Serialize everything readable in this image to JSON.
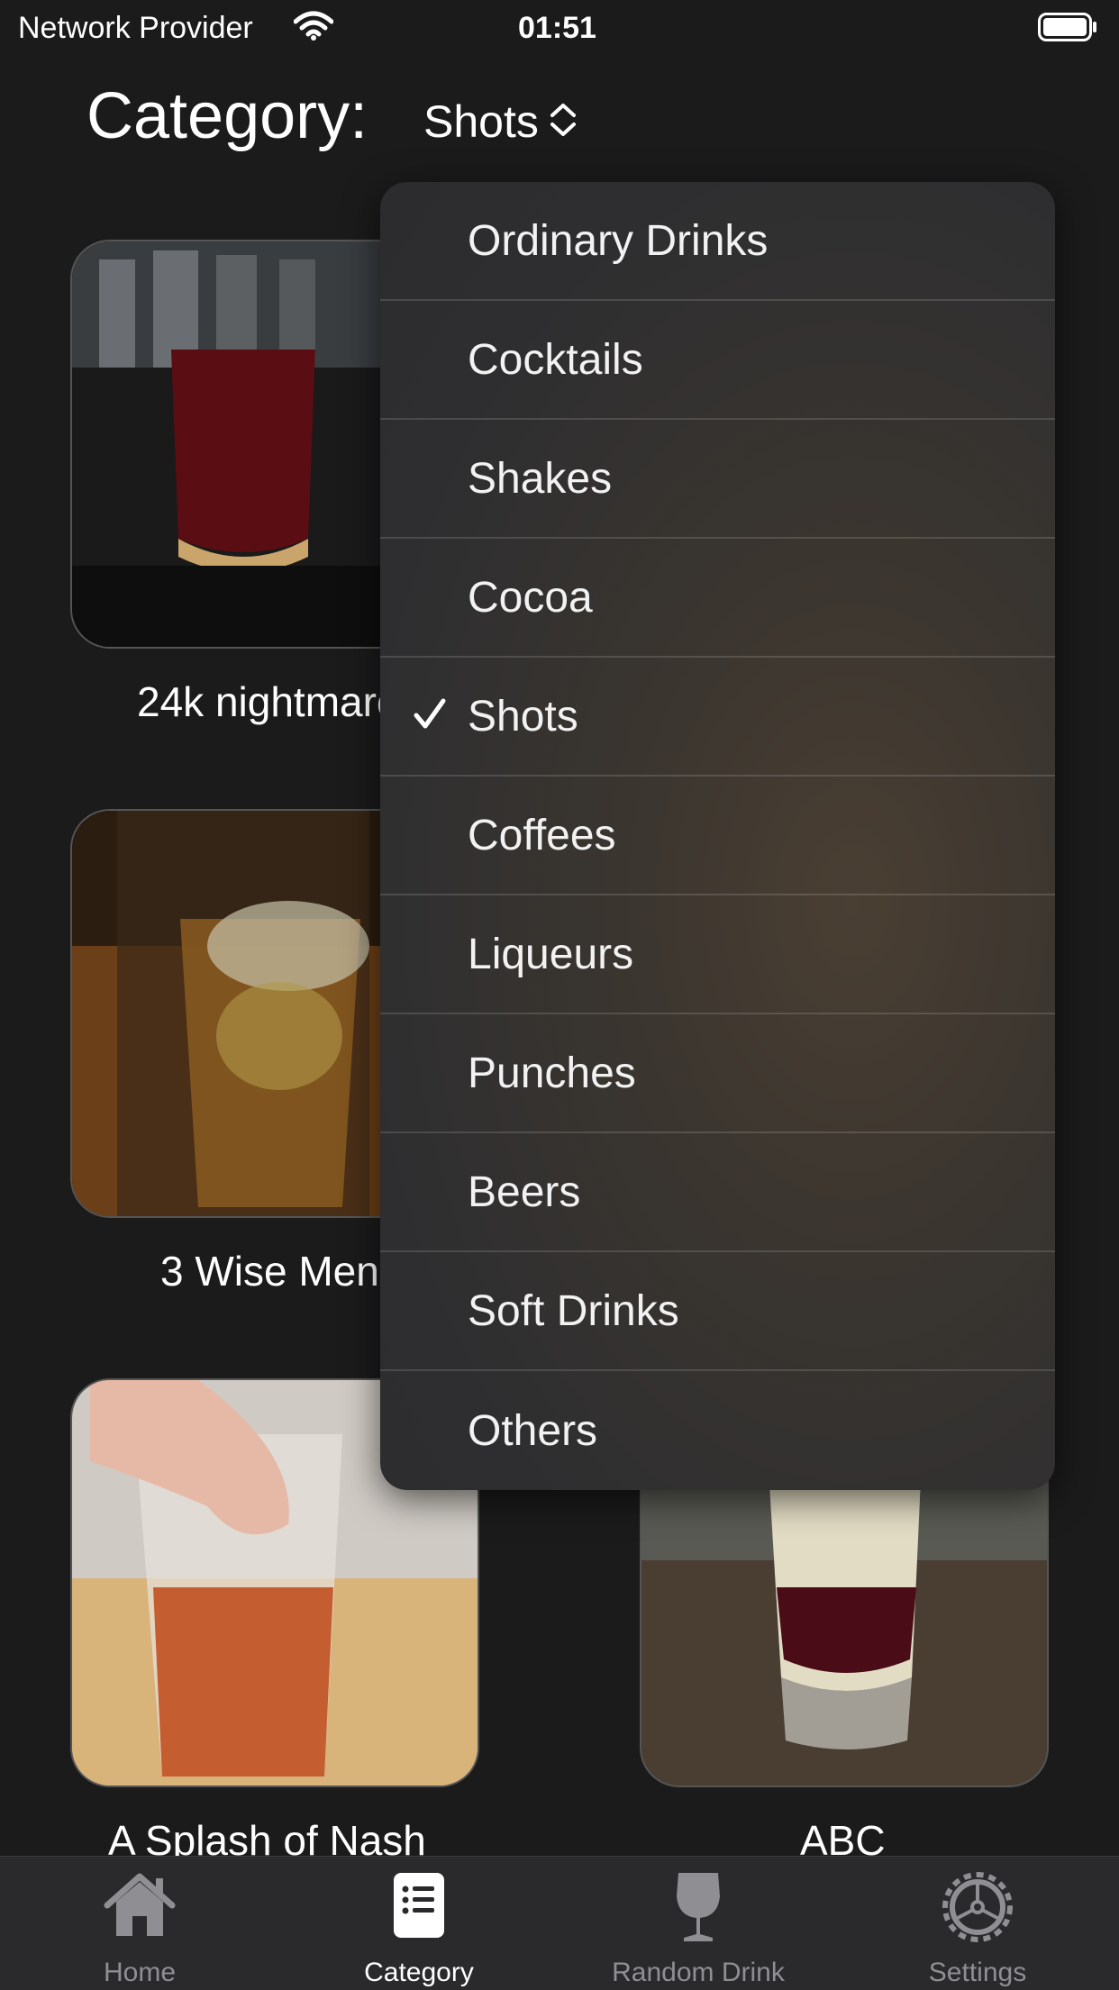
{
  "status_bar": {
    "carrier": "Network Provider",
    "time": "01:51"
  },
  "header": {
    "title": "Category:",
    "picker_value": "Shots"
  },
  "grid": {
    "items": [
      {
        "label": "24k nightmare"
      },
      {
        "label": "3 Wise Men"
      },
      {
        "label": "A Splash of Nash"
      },
      {
        "label": "ABC"
      }
    ]
  },
  "dropdown": {
    "selected": "Shots",
    "items": [
      {
        "label": "Ordinary Drinks"
      },
      {
        "label": "Cocktails"
      },
      {
        "label": "Shakes"
      },
      {
        "label": "Cocoa"
      },
      {
        "label": "Shots"
      },
      {
        "label": "Coffees"
      },
      {
        "label": "Liqueurs"
      },
      {
        "label": "Punches"
      },
      {
        "label": "Beers"
      },
      {
        "label": "Soft Drinks"
      },
      {
        "label": "Others"
      }
    ]
  },
  "tabbar": {
    "active": "Category",
    "tabs": [
      {
        "label": "Home",
        "icon": "house-icon"
      },
      {
        "label": "Category",
        "icon": "list-icon"
      },
      {
        "label": "Random Drink",
        "icon": "wine-glass-icon"
      },
      {
        "label": "Settings",
        "icon": "gear-icon"
      }
    ]
  },
  "colors": {
    "background": "#1b1b1c",
    "tabbar": "#2a2a2c",
    "inactive": "#8e8e93"
  }
}
